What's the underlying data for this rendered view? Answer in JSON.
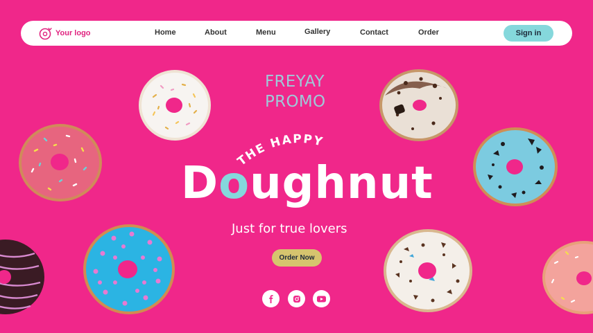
{
  "nav": {
    "logo_text": "Your logo",
    "links": [
      "Home",
      "About",
      "Menu",
      "Gallery",
      "Contact",
      "Order"
    ],
    "signin_label": "Sign in"
  },
  "hero": {
    "promo_line1": "FREYAY",
    "promo_line2": "PROMO",
    "kicker": "THE HAPPY",
    "headline_first": "D",
    "headline_o": "o",
    "headline_rest": "ughnut",
    "tagline": "Just for true lovers",
    "order_label": "Order Now"
  },
  "social": [
    "facebook-icon",
    "instagram-icon",
    "youtube-icon"
  ],
  "colors": {
    "background": "#f0278a",
    "accent_teal": "#85d8dc",
    "button_gold": "#d6c46e",
    "logo_pink": "#e0237f"
  }
}
